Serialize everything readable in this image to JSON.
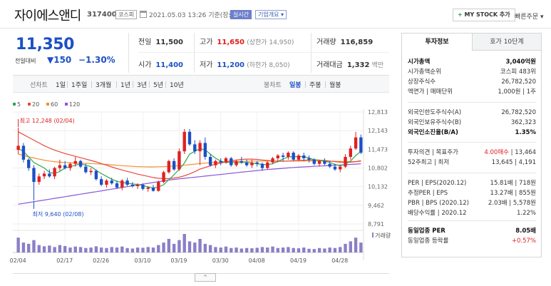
{
  "header": {
    "stock_name": "자이에스앤디",
    "stock_code": "317400",
    "market_tag": "코스피",
    "datetime": "2021.05.03 13:26 기준(장중)",
    "realtime_tag": "실시간",
    "overview_tag": "기업개요 ▾",
    "mystock_plus": "+",
    "mystock_label": "MY STOCK 추가",
    "quick_order": "빠른주문 ▾"
  },
  "price": {
    "current": "11,350",
    "change_label": "전일대비",
    "change_value": "▼150",
    "change_pct": "−1.30%",
    "colors": {
      "down": "#1c50c6",
      "up": "#e02020"
    }
  },
  "quote": {
    "prev_close_label": "전일",
    "prev_close": "11,500",
    "high_label": "고가",
    "high": "11,650",
    "upper_limit": "(상한가 14,950)",
    "volume_label": "거래량",
    "volume": "116,859",
    "open_label": "시가",
    "open": "11,400",
    "low_label": "저가",
    "low": "11,200",
    "lower_limit": "(하한가 8,050)",
    "amount_label": "거래대금",
    "amount": "1,332",
    "amount_unit": "백만"
  },
  "period_bar": {
    "line_chart": "선차트",
    "ranges": [
      "1일",
      "1주일",
      "3개월",
      "1년",
      "3년",
      "5년",
      "10년"
    ],
    "candle": "봉차트",
    "intervals": [
      "일봉",
      "주봉",
      "월봉"
    ],
    "active_interval": "일봉"
  },
  "chart_data": {
    "type": "candlestick",
    "legend": [
      {
        "name": "5",
        "color": "#2fa84f"
      },
      {
        "name": "20",
        "color": "#e84a3c"
      },
      {
        "name": "60",
        "color": "#f0922e"
      },
      {
        "name": "120",
        "color": "#8a57d8"
      }
    ],
    "y_ticks": [
      "12,813",
      "12,143",
      "11,473",
      "10,802",
      "10,132",
      "9,462",
      "8,791"
    ],
    "ylim": [
      8791,
      12813
    ],
    "x_ticks": [
      "02/04",
      "02/17",
      "02/26",
      "03/10",
      "03/19",
      "03/30",
      "04/08",
      "04/19",
      "04/28"
    ],
    "max_annotation": "최고 12,248 (02/04)",
    "min_annotation": "최저 9,640 (02/08)",
    "volume_label": "거래량",
    "candles": [
      [
        11450,
        12248,
        11300,
        11600
      ],
      [
        11600,
        11700,
        11000,
        11100
      ],
      [
        11100,
        11150,
        10700,
        10800
      ],
      [
        10800,
        10900,
        9640,
        10300
      ],
      [
        10300,
        10600,
        10200,
        10500
      ],
      [
        10500,
        10700,
        10400,
        10600
      ],
      [
        10600,
        10750,
        10450,
        10500
      ],
      [
        10500,
        10850,
        10400,
        10800
      ],
      [
        10800,
        11100,
        10700,
        10900
      ],
      [
        10900,
        11050,
        10750,
        10800
      ],
      [
        10800,
        11000,
        10700,
        10950
      ],
      [
        10950,
        11200,
        10850,
        11050
      ],
      [
        11050,
        11100,
        10800,
        10850
      ],
      [
        10850,
        10950,
        10600,
        10650
      ],
      [
        10650,
        10800,
        10550,
        10700
      ],
      [
        10700,
        10750,
        10350,
        10400
      ],
      [
        10400,
        10500,
        10150,
        10200
      ],
      [
        10200,
        10400,
        10100,
        10350
      ],
      [
        10350,
        10450,
        10200,
        10250
      ],
      [
        10250,
        10350,
        10050,
        10100
      ],
      [
        10100,
        10400,
        10000,
        10350
      ],
      [
        10350,
        10450,
        10150,
        10200
      ],
      [
        10200,
        10300,
        10100,
        10150
      ],
      [
        10150,
        10250,
        10050,
        10200
      ],
      [
        10200,
        10250,
        10000,
        10050
      ],
      [
        10050,
        10150,
        9950,
        10100
      ],
      [
        10100,
        10200,
        9950,
        9980
      ],
      [
        9980,
        10350,
        9950,
        10300
      ],
      [
        10300,
        10700,
        10250,
        10650
      ],
      [
        10650,
        11100,
        10600,
        11050
      ],
      [
        11050,
        11150,
        10700,
        10750
      ],
      [
        10750,
        11500,
        10700,
        11400
      ],
      [
        11400,
        12200,
        11300,
        12100
      ],
      [
        12100,
        12200,
        11600,
        11650
      ],
      [
        11650,
        11800,
        11300,
        11400
      ],
      [
        11400,
        11800,
        10900,
        11700
      ],
      [
        11700,
        11900,
        11100,
        11200
      ],
      [
        11200,
        11300,
        10850,
        10900
      ],
      [
        10900,
        11100,
        10800,
        11050
      ],
      [
        11050,
        11150,
        10900,
        11000
      ],
      [
        11000,
        11200,
        10950,
        11150
      ],
      [
        11150,
        11200,
        10850,
        10900
      ],
      [
        10900,
        11100,
        10850,
        11050
      ],
      [
        11050,
        11200,
        10950,
        11000
      ],
      [
        11000,
        11100,
        10850,
        10900
      ],
      [
        10900,
        11100,
        10800,
        11000
      ],
      [
        11000,
        11050,
        10850,
        10950
      ],
      [
        10950,
        11000,
        10700,
        10800
      ],
      [
        10800,
        11050,
        10750,
        11000
      ],
      [
        11000,
        11200,
        10950,
        11150
      ],
      [
        11150,
        11300,
        11000,
        11250
      ],
      [
        11250,
        11350,
        11050,
        11200
      ],
      [
        11200,
        11400,
        11100,
        11350
      ],
      [
        11350,
        11400,
        11050,
        11100
      ],
      [
        11100,
        11300,
        11050,
        11250
      ],
      [
        11250,
        11350,
        11050,
        11150
      ],
      [
        11150,
        11250,
        11000,
        11100
      ],
      [
        11100,
        11150,
        10900,
        10950
      ],
      [
        10950,
        11100,
        10850,
        11050
      ],
      [
        11050,
        11150,
        10900,
        10950
      ],
      [
        10950,
        11050,
        10800,
        10850
      ],
      [
        10850,
        10950,
        10700,
        10750
      ],
      [
        10750,
        10900,
        10650,
        10850
      ],
      [
        10850,
        11300,
        10800,
        11200
      ],
      [
        11200,
        11600,
        11100,
        11500
      ],
      [
        11500,
        12100,
        11450,
        11900
      ],
      [
        11900,
        12000,
        11300,
        11350
      ]
    ],
    "ma5": [
      11500,
      11400,
      11200,
      11000,
      10900,
      10800,
      10650,
      10600,
      10680,
      10800,
      10850,
      10900,
      10950,
      10900,
      10850,
      10720,
      10600,
      10500,
      10400,
      10320,
      10280,
      10250,
      10230,
      10210,
      10170,
      10120,
      10080,
      10120,
      10200,
      10380,
      10560,
      10750,
      10980,
      11300,
      11400,
      11500,
      11450,
      11300,
      11150,
      11050,
      11000,
      11000,
      10990,
      11000,
      11000,
      10980,
      10950,
      10930,
      10920,
      10950,
      11040,
      11120,
      11200,
      11210,
      11210,
      11210,
      11160,
      11100,
      11080,
      11050,
      11000,
      10930,
      10880,
      10940,
      11050,
      11250,
      11400
    ],
    "ma20": [
      12100,
      12000,
      11900,
      11800,
      11700,
      11600,
      11520,
      11440,
      11380,
      11320,
      11270,
      11220,
      11170,
      11120,
      11070,
      11020,
      10960,
      10900,
      10840,
      10780,
      10730,
      10680,
      10630,
      10580,
      10540,
      10500,
      10460,
      10430,
      10420,
      10420,
      10440,
      10470,
      10520,
      10590,
      10670,
      10760,
      10820,
      10880,
      10940,
      10980,
      11020,
      11060,
      11090,
      11110,
      11120,
      11120,
      11110,
      11090,
      11070,
      11050,
      11040,
      11040,
      11050,
      11060,
      11070,
      11080,
      11090,
      11090,
      11080,
      11070,
      11050,
      11030,
      11010,
      11000,
      11010,
      11030,
      11060
    ],
    "ma60": [
      11300,
      11250,
      11200,
      11160,
      11120,
      11080,
      11050,
      11030,
      11010,
      11000,
      10990,
      10980,
      10970,
      10965,
      10960,
      10950,
      10940,
      10930,
      10915,
      10900,
      10885,
      10870,
      10860,
      10850,
      10845,
      10840,
      10840,
      10845,
      10850,
      10860,
      10870,
      10885,
      10900,
      10920,
      10940,
      10960,
      10975,
      10990,
      11000,
      11010,
      11020,
      11030,
      11035,
      11040,
      11045,
      11050,
      11050,
      11050,
      11050,
      11050,
      11050,
      11050,
      11050,
      11050,
      11050,
      11050,
      11050,
      11050,
      11050,
      11050,
      11045,
      11040,
      11035,
      11030,
      11030,
      11030,
      11040
    ],
    "ma120": [
      9500,
      9530,
      9560,
      9590,
      9620,
      9650,
      9680,
      9710,
      9740,
      9770,
      9800,
      9830,
      9860,
      9890,
      9920,
      9950,
      9980,
      10010,
      10040,
      10070,
      10100,
      10130,
      10160,
      10190,
      10220,
      10250,
      10280,
      10310,
      10340,
      10370,
      10390,
      10410,
      10430,
      10450,
      10470,
      10490,
      10510,
      10530,
      10550,
      10570,
      10590,
      10610,
      10630,
      10650,
      10670,
      10690,
      10710,
      10730,
      10745,
      10760,
      10775,
      10790,
      10805,
      10820,
      10830,
      10840,
      10850,
      10860,
      10870,
      10880,
      10890,
      10900,
      10910,
      10920,
      10930,
      10940,
      10950
    ],
    "volumes": [
      60,
      40,
      35,
      50,
      30,
      25,
      28,
      22,
      30,
      26,
      20,
      24,
      22,
      18,
      20,
      25,
      20,
      18,
      22,
      20,
      24,
      18,
      16,
      20,
      19,
      22,
      20,
      30,
      40,
      55,
      35,
      50,
      75,
      45,
      40,
      55,
      35,
      30,
      22,
      20,
      24,
      18,
      20,
      16,
      18,
      17,
      19,
      22,
      20,
      24,
      18,
      20,
      22,
      18,
      17,
      20,
      15,
      14,
      18,
      16,
      20,
      18,
      22,
      35,
      45,
      60,
      40
    ],
    "volume_max": 75
  },
  "panel": {
    "tab_info": "투자정보",
    "tab_orderbook": "호가 10단계",
    "rows": [
      {
        "k": "시가총액",
        "v": "3,040억원",
        "bold": true
      },
      {
        "k": "시가총액순위",
        "v": "코스피 483위"
      },
      {
        "k": "상장주식수",
        "v": "26,782,520"
      },
      {
        "k": "액면가 | 매매단위",
        "v": "1,000원 | 1주"
      },
      {
        "k": "외국인한도주식수(A)",
        "v": "26,782,520"
      },
      {
        "k": "외국인보유주식수(B)",
        "v": "362,323"
      },
      {
        "k": "외국인소진율(B/A)",
        "v": "1.35%",
        "bold": true
      },
      {
        "k": "투자의견 | 목표주가",
        "v_red": "4.00매수",
        "v": " | 13,464"
      },
      {
        "k": "52주최고 | 최저",
        "v": "13,645 | 4,191"
      },
      {
        "k": "PER | EPS(2020.12)",
        "v": "15.81배 | 718원"
      },
      {
        "k": "추정PER | EPS",
        "v": "13.27배 | 855원"
      },
      {
        "k": "PBR | BPS (2020.12)",
        "v": "2.03배 | 5,578원"
      },
      {
        "k": "배당수익률 | 2020.12",
        "v": "1.22%"
      },
      {
        "k": "동일업종 PER",
        "v": "8.05배",
        "bold": true
      },
      {
        "k": "동일업종 등락률",
        "v_red": "+0.57%"
      }
    ]
  },
  "scroll_handle": "^"
}
